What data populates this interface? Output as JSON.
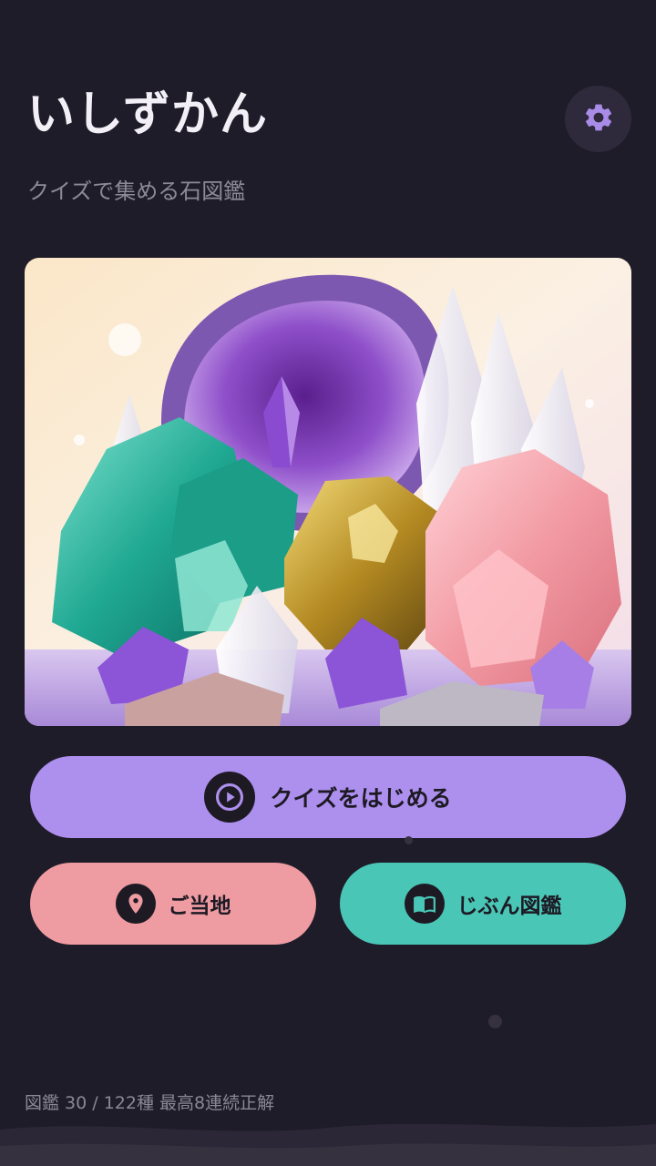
{
  "app": {
    "title": "いしずかん",
    "subtitle": "クイズで集める石図鑑"
  },
  "header": {
    "settings_icon": "gear-icon"
  },
  "hero": {
    "description_icon": "crystal-gem-illustration"
  },
  "buttons": {
    "quiz": {
      "label": "クイズをはじめる",
      "icon": "play-circle-icon",
      "color": "#ad8fee"
    },
    "local": {
      "label": "ご当地",
      "icon": "location-pin-icon",
      "color": "#ef9ba2"
    },
    "book": {
      "label": "じぶん図鑑",
      "icon": "book-icon",
      "color": "#4ac6b6"
    }
  },
  "footer": {
    "stats_text": "図鑑 30 / 122種 最高8連続正解"
  },
  "colors": {
    "background": "#1f1c29",
    "accent_purple": "#ad8fee",
    "accent_pink": "#ef9ba2",
    "accent_teal": "#4ac6b6"
  }
}
